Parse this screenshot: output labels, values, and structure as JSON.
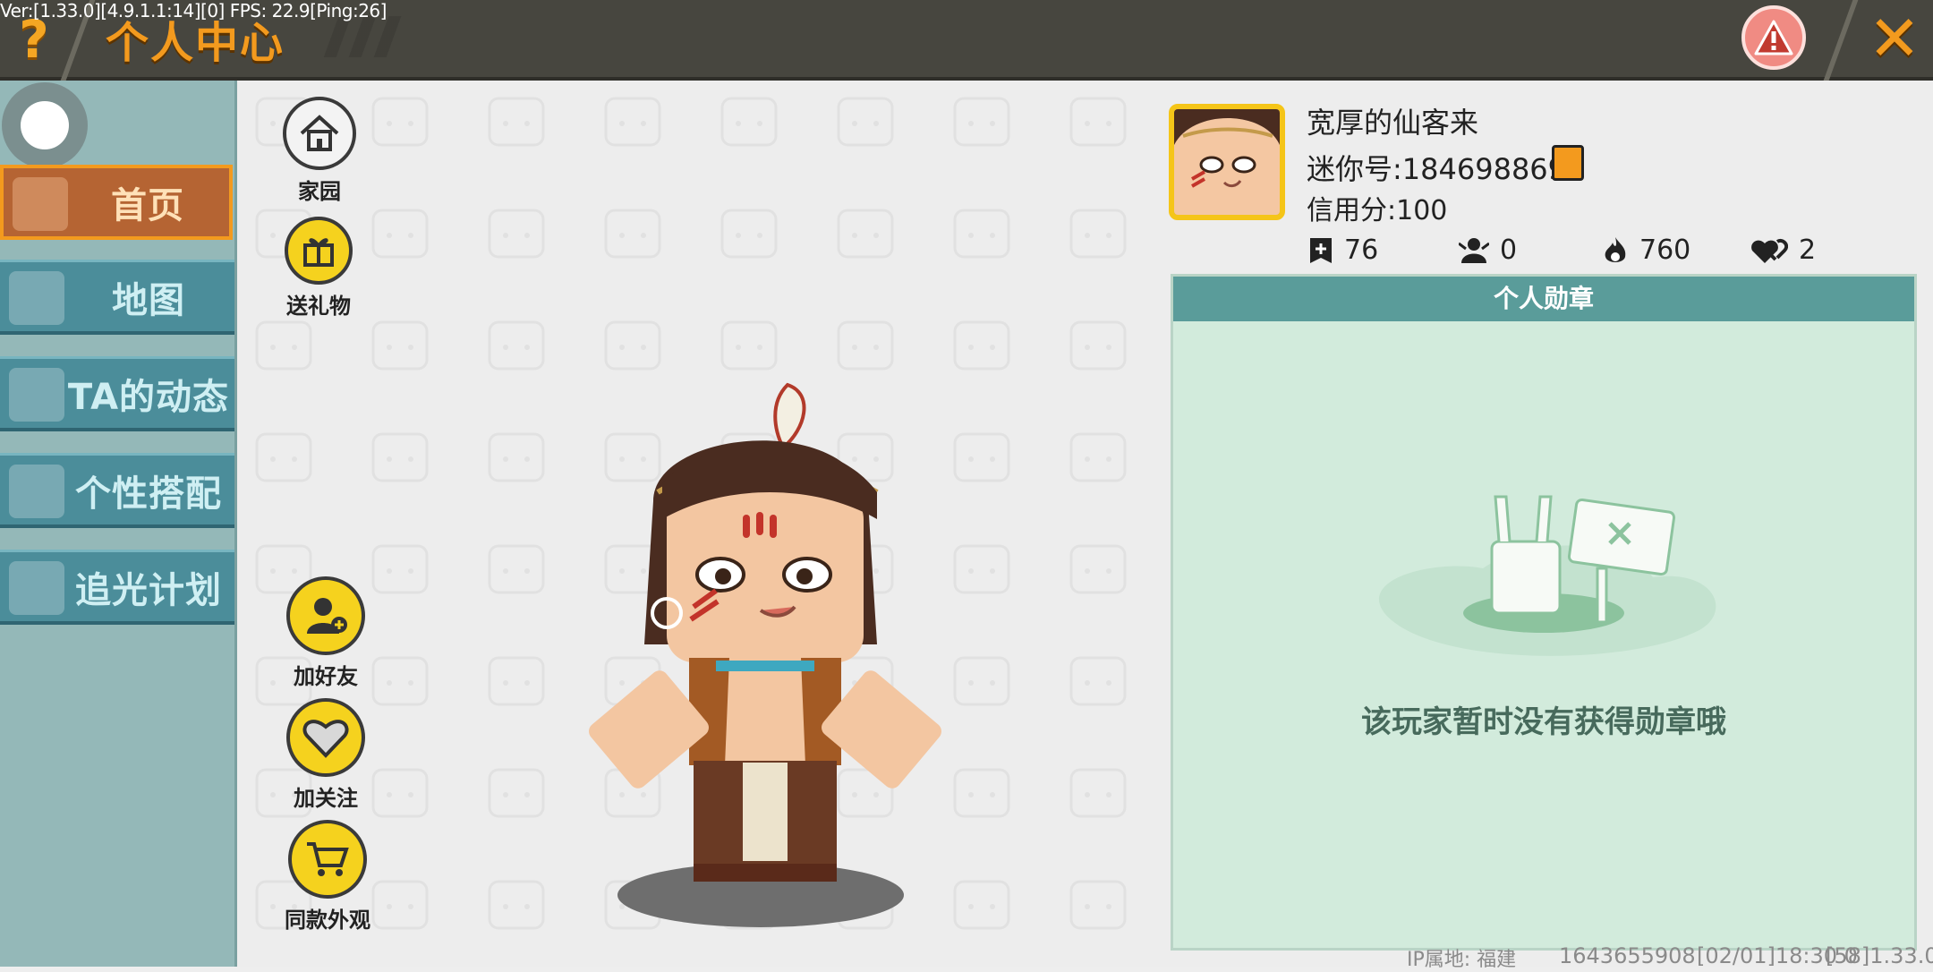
{
  "debug_version": "Ver:[1.33.0][4.9.1.1:14][0] FPS: 22.9[Ping:26]",
  "header": {
    "help_icon": "question-mark",
    "title": "个人中心",
    "report_icon": "warning-icon",
    "close_icon": "close-x"
  },
  "sidebar": {
    "items": [
      {
        "label": "首页",
        "icon": "home-icon",
        "active": true
      },
      {
        "label": "地图",
        "icon": "map-icon",
        "active": false
      },
      {
        "label": "TA的动态",
        "icon": "bell-icon",
        "active": false
      },
      {
        "label": "个性搭配",
        "icon": "outfit-icon",
        "active": false
      },
      {
        "label": "追光计划",
        "icon": "plan-icon",
        "active": false
      }
    ]
  },
  "actions": {
    "home_label": "家园",
    "gift_label": "送礼物",
    "add_friend_label": "加好友",
    "follow_label": "加关注",
    "same_outfit_label": "同款外观"
  },
  "profile": {
    "name": "宽厚的仙客来",
    "mini_id": "迷你号:1846988691",
    "credit": "信用分:100",
    "stats": {
      "plus": "76",
      "fans": "0",
      "heat": "760",
      "likes": "2"
    }
  },
  "medals": {
    "title": "个人勋章",
    "empty_text": "该玩家暂时没有获得勋章哦"
  },
  "footer": {
    "ip": "IP属地: 福建",
    "build": "1643655908",
    "time": "[02/01]18:30 0",
    "ver": "[58]1.33.0"
  },
  "colors": {
    "accent": "#f39a1e",
    "sidebar_bg": "#94b8b8",
    "nav_bg": "#4b8d9a",
    "panel_bg": "#d2ebdc",
    "panel_header": "#5a9c9a"
  }
}
